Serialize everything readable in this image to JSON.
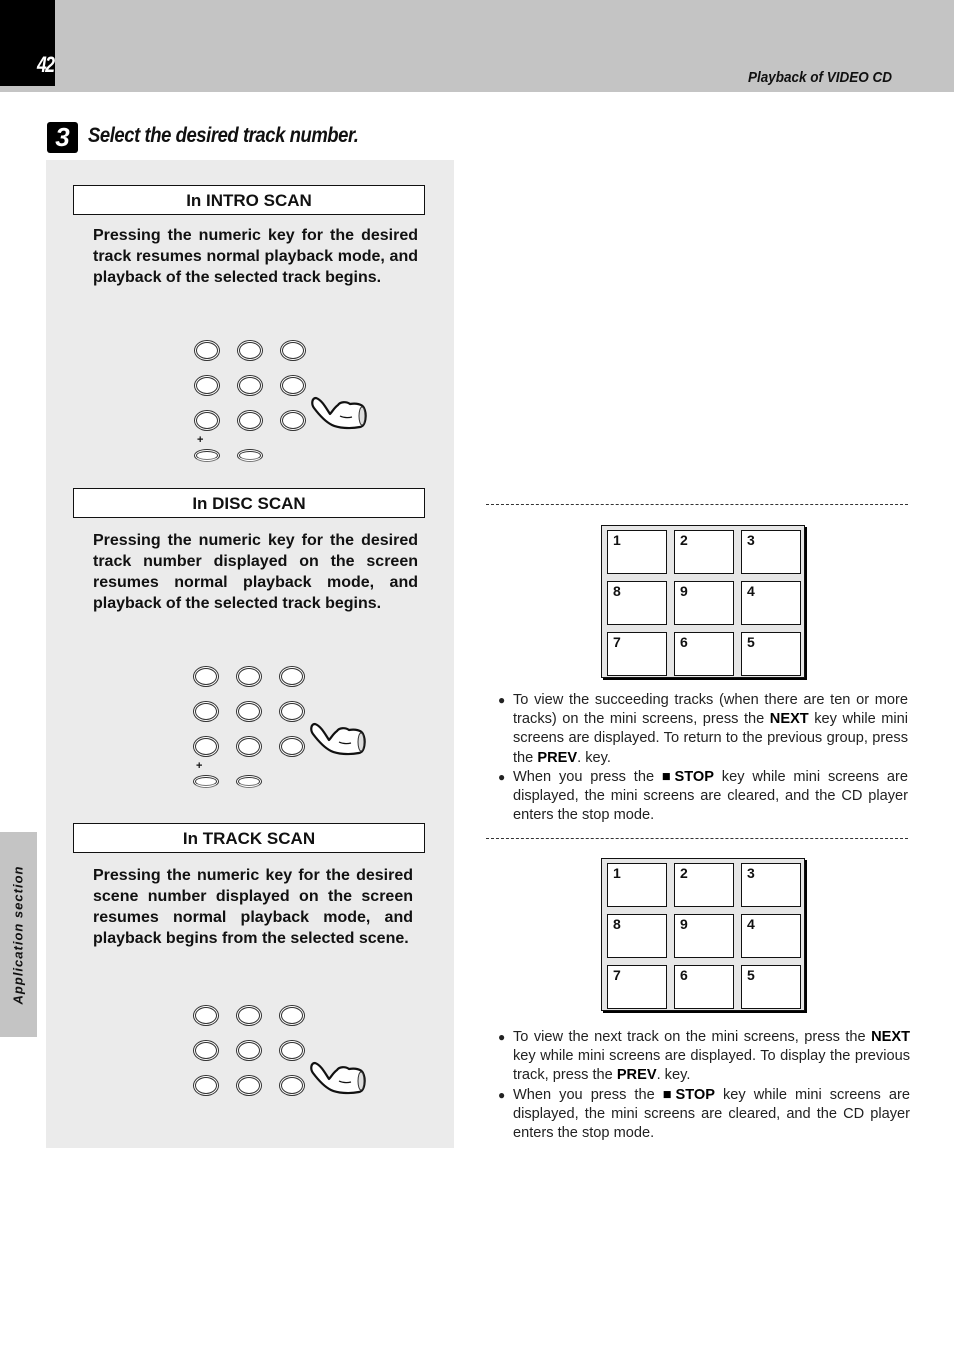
{
  "header": {
    "page_number": "42",
    "section_title": "Playback of VIDEO CD"
  },
  "step": {
    "number": "3",
    "title": "Select the desired track number."
  },
  "side_tab": {
    "label": "Application section"
  },
  "modes": [
    {
      "heading": "In INTRO SCAN",
      "text": "Pressing the numeric key for the desired track resumes normal playback mode, and playback of the selected track begins.",
      "keypad_plus_label": "+"
    },
    {
      "heading": "In DISC SCAN",
      "text": "Pressing the numeric key for the desired track number displayed on the screen resumes normal playback mode, and playback of the selected track begins.",
      "keypad_plus_label": "+"
    },
    {
      "heading": "In TRACK SCAN",
      "text": "Pressing the numeric key for the desired scene number displayed on the screen resumes normal playback mode, and playback begins from the selected scene."
    }
  ],
  "mini_screens": [
    {
      "cells": [
        "1",
        "2",
        "3",
        "8",
        "9",
        "4",
        "7",
        "6",
        "5"
      ],
      "notes": [
        {
          "parts": [
            {
              "t": "To view the succeeding tracks (when there are ten or more tracks) on the mini screens, press the "
            },
            {
              "t": "NEXT",
              "b": true
            },
            {
              "t": " key while mini screens are displayed.  To return to the previous group, press the "
            },
            {
              "t": "PREV",
              "b": true
            },
            {
              "t": ". key."
            }
          ]
        },
        {
          "parts": [
            {
              "t": "When you press the "
            },
            {
              "t": "■STOP",
              "b": true
            },
            {
              "t": " key while mini screens are displayed, the mini screens are cleared, and the CD player enters the stop mode."
            }
          ]
        }
      ]
    },
    {
      "cells": [
        "1",
        "2",
        "3",
        "8",
        "9",
        "4",
        "7",
        "6",
        "5"
      ],
      "notes": [
        {
          "parts": [
            {
              "t": "To view the next track on the mini screens, press the "
            },
            {
              "t": "NEXT",
              "b": true
            },
            {
              "t": " key while mini screens are displayed.  To display the previous track, press the "
            },
            {
              "t": "PREV",
              "b": true
            },
            {
              "t": ". key."
            }
          ]
        },
        {
          "parts": [
            {
              "t": "When you press the "
            },
            {
              "t": "■STOP",
              "b": true
            },
            {
              "t": " key while mini screens are displayed, the mini screens are cleared, and the CD player enters the stop mode."
            }
          ]
        }
      ]
    }
  ],
  "bullet_glyph": "●"
}
